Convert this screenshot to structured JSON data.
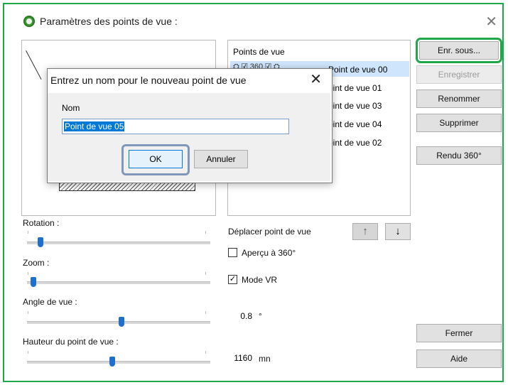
{
  "window": {
    "title": "Paramètres des points de vue :",
    "close_glyph": "✕"
  },
  "viewpoints": {
    "header": "Points de vue",
    "icons_row": "⛭ ☑ 360 ☑ ⛭",
    "items": [
      "Point de vue 00",
      "oint de vue 01",
      "oint de vue 03",
      "oint de vue 04",
      "oint de vue 02"
    ]
  },
  "buttons": {
    "save_as": "Enr. sous...",
    "save": "Enregistrer",
    "rename": "Renommer",
    "delete": "Supprimer",
    "render360": "Rendu 360°",
    "close": "Fermer",
    "help": "Aide"
  },
  "move": {
    "label": "Déplacer point de vue",
    "up": "↑",
    "down": "↓"
  },
  "options": {
    "preview360": {
      "label": "Aperçu à 360°",
      "checked": false
    },
    "vr_mode": {
      "label": "Mode VR",
      "checked": true
    }
  },
  "sliders": {
    "rotation": {
      "label": "Rotation :",
      "level": 0.06
    },
    "zoom": {
      "label": "Zoom :",
      "level": 0.02
    },
    "view_angle": {
      "label": "Angle de vue :",
      "level": 0.5,
      "value": "0.8",
      "unit": "°"
    },
    "height": {
      "label": "Hauteur du point de vue :",
      "level": 0.45,
      "value": "1160",
      "unit": "mn"
    }
  },
  "dialog": {
    "title": "Entrez un nom pour le nouveau point de vue",
    "close_glyph": "✕",
    "name_label": "Nom",
    "name_value": "Point de vue 05",
    "ok": "OK",
    "cancel": "Annuler"
  },
  "colors": {
    "accent_green": "#1ea84a",
    "selection_blue": "#0078d7",
    "thumb_blue": "#1f6fd1"
  }
}
